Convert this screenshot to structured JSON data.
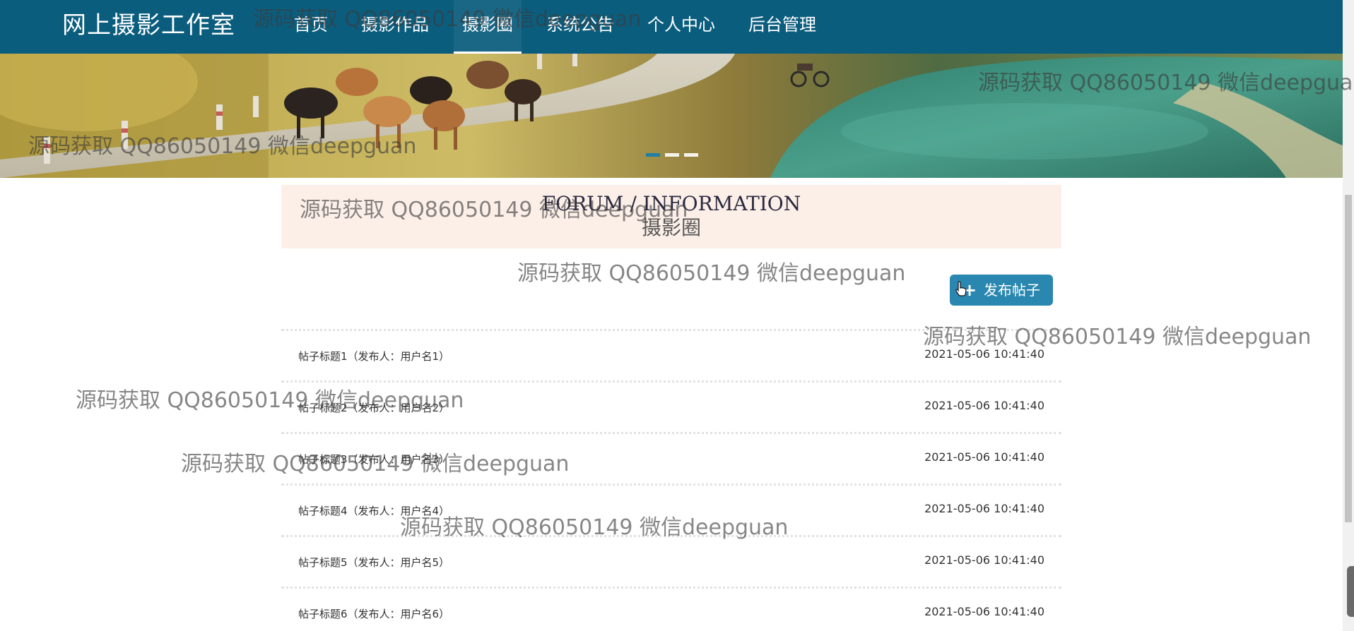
{
  "header": {
    "brand": "网上摄影工作室",
    "nav": [
      {
        "label": "首页",
        "active": false
      },
      {
        "label": "摄影作品",
        "active": false
      },
      {
        "label": "摄影圈",
        "active": true
      },
      {
        "label": "系统公告",
        "active": false
      },
      {
        "label": "个人中心",
        "active": false
      },
      {
        "label": "后台管理",
        "active": false
      }
    ],
    "colors": {
      "nav_bg": "#0b5d7e",
      "accent": "#2a87b0"
    }
  },
  "banner": {
    "slide_count": 3,
    "active_slide": 1
  },
  "section": {
    "title_en": "FORUM / INFORMATION",
    "title_cn": "摄影圈"
  },
  "actions": {
    "publish_label": "发布帖子"
  },
  "posts": [
    {
      "title": "帖子标题1（发布人：用户名1）",
      "time": "2021-05-06 10:41:40"
    },
    {
      "title": "帖子标题2（发布人：用户名2）",
      "time": "2021-05-06 10:41:40"
    },
    {
      "title": "帖子标题3（发布人：用户名3）",
      "time": "2021-05-06 10:41:40"
    },
    {
      "title": "帖子标题4（发布人：用户名4）",
      "time": "2021-05-06 10:41:40"
    },
    {
      "title": "帖子标题5（发布人：用户名5）",
      "time": "2021-05-06 10:41:40"
    },
    {
      "title": "帖子标题6（发布人：用户名6）",
      "time": "2021-05-06 10:41:40"
    }
  ],
  "watermark": {
    "text": "源码获取 QQ86050149 微信deepguan"
  }
}
